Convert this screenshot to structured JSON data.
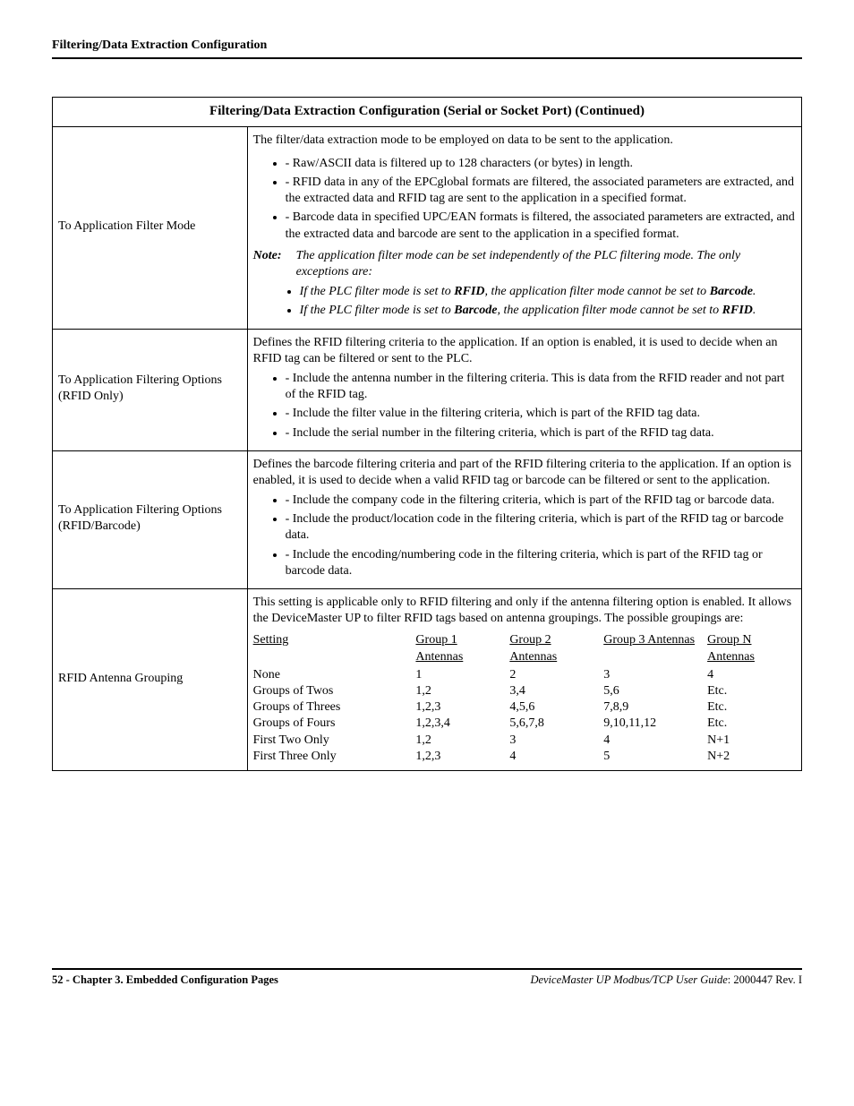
{
  "header": {
    "title": "Filtering/Data Extraction Configuration"
  },
  "table": {
    "caption": "Filtering/Data Extraction Configuration (Serial or Socket Port) (Continued)",
    "rows": [
      {
        "label": "To Application Filter Mode",
        "intro": "The filter/data extraction mode to be employed on data to be sent to the application.",
        "bullets": [
          "- Raw/ASCII data is filtered up to 128 characters (or bytes) in length.",
          "- RFID data in any of the EPCglobal formats are filtered, the associated parameters are extracted, and the extracted data and RFID tag are sent to the application in a specified format.",
          "- Barcode data in specified UPC/EAN formats is filtered, the associated parameters are extracted, and the extracted data and barcode are sent to the application in a specified format."
        ],
        "note_label": "Note:",
        "note_text": "The application filter mode can be set independently of the PLC filtering mode. The only exceptions are:",
        "sub_bullets_pre": [
          "If the PLC filter mode is set to ",
          ", the application filter mode cannot be set to ",
          "."
        ],
        "sub_bullets_pre2": [
          "If the PLC filter mode is set to ",
          ", the application filter mode cannot be set to ",
          "."
        ],
        "rfid": "RFID",
        "barcode": "Barcode"
      },
      {
        "label": "To Application Filtering Options (RFID Only)",
        "intro": "Defines the RFID filtering criteria to the application. If an option is enabled, it is used to decide when an RFID tag can be filtered or sent to the PLC.",
        "bullets": [
          "- Include the antenna number in the filtering criteria. This is data from the RFID reader and not part of the RFID tag.",
          "- Include the filter value in the filtering criteria, which is part of the RFID tag data.",
          "- Include the serial number in the filtering criteria, which is part of the RFID tag data."
        ]
      },
      {
        "label": "To Application Filtering Options (RFID/Barcode)",
        "intro": "Defines the barcode filtering criteria and part of the RFID filtering criteria to the application. If an option is enabled, it is used to decide when a valid RFID tag or barcode can be filtered or sent to the application.",
        "bullets": [
          "- Include the company code in the filtering criteria, which is part of the RFID tag or barcode data.",
          "- Include the product/location code in the filtering criteria, which is part of the RFID tag or barcode data.",
          "- Include the encoding/numbering code in the filtering criteria, which is part of the RFID tag or barcode data."
        ]
      },
      {
        "label": "RFID Antenna Grouping",
        "intro": "This setting is applicable only to RFID filtering and only if the antenna filtering option is enabled. It allows the DeviceMaster UP to filter RFID tags based on antenna groupings. The possible groupings are:",
        "grid": {
          "headers": [
            "Setting",
            "Group 1 Antennas",
            "Group 2 Antennas",
            "Group 3 Antennas",
            "Group N Antennas"
          ],
          "rows": [
            [
              "None",
              "1",
              "2",
              "3",
              "4"
            ],
            [
              "Groups of Twos",
              "1,2",
              "3,4",
              "5,6",
              "Etc."
            ],
            [
              "Groups of Threes",
              "1,2,3",
              "4,5,6",
              "7,8,9",
              "Etc."
            ],
            [
              "Groups of Fours",
              "1,2,3,4",
              "5,6,7,8",
              "9,10,11,12",
              "Etc."
            ],
            [
              "First Two Only",
              "1,2",
              "3",
              "4",
              "N+1"
            ],
            [
              "First Three Only",
              "1,2,3",
              "4",
              "5",
              "N+2"
            ]
          ]
        }
      }
    ]
  },
  "footer": {
    "left_page": "52 -",
    "left_text": "Chapter 3. Embedded Configuration Pages",
    "right_title": "DeviceMaster UP Modbus/TCP User Guide",
    "right_rev": ": 2000447 Rev. I"
  }
}
